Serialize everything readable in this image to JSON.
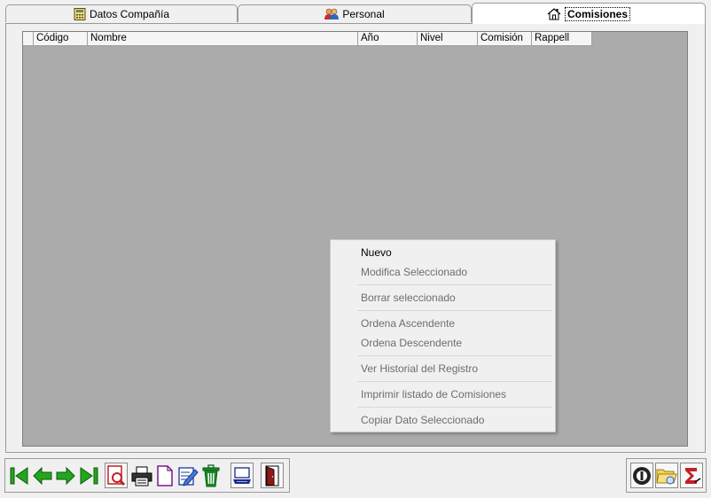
{
  "tabs": [
    {
      "label": "Datos Compañía",
      "icon": "calculator-icon"
    },
    {
      "label": "Personal",
      "icon": "users-icon"
    },
    {
      "label": "Comisiones",
      "icon": "house-icon",
      "active": true
    }
  ],
  "grid": {
    "columns": [
      "",
      "Código",
      "Nombre",
      "Año",
      "Nivel",
      "Comisión",
      "Rappell"
    ]
  },
  "context_menu": {
    "items": [
      {
        "label": "Nuevo",
        "enabled": true
      },
      {
        "label": "Modifica Seleccionado",
        "enabled": false
      },
      {
        "separator": true
      },
      {
        "label": "Borrar seleccionado",
        "enabled": false
      },
      {
        "separator": true
      },
      {
        "label": "Ordena Ascendente",
        "enabled": false
      },
      {
        "label": "Ordena Descendente",
        "enabled": false
      },
      {
        "separator": true
      },
      {
        "label": "Ver Historial del Registro",
        "enabled": false
      },
      {
        "separator": true
      },
      {
        "label": "Imprimir listado de Comisiones",
        "enabled": false
      },
      {
        "separator": true
      },
      {
        "label": "Copiar Dato Seleccionado",
        "enabled": false
      }
    ]
  },
  "toolbar": {
    "buttons": [
      "first-record-icon",
      "previous-record-icon",
      "next-record-icon",
      "last-record-icon",
      "print-preview-icon",
      "print-icon",
      "new-document-icon",
      "edit-icon",
      "delete-icon",
      "scanner-icon",
      "exit-door-icon"
    ],
    "right_buttons": [
      "help-icon",
      "open-folder-icon",
      "sum-icon"
    ]
  },
  "colors": {
    "grid_bg": "#ababab",
    "nav_green": "#22a71c",
    "accent_red": "#c0202a"
  }
}
